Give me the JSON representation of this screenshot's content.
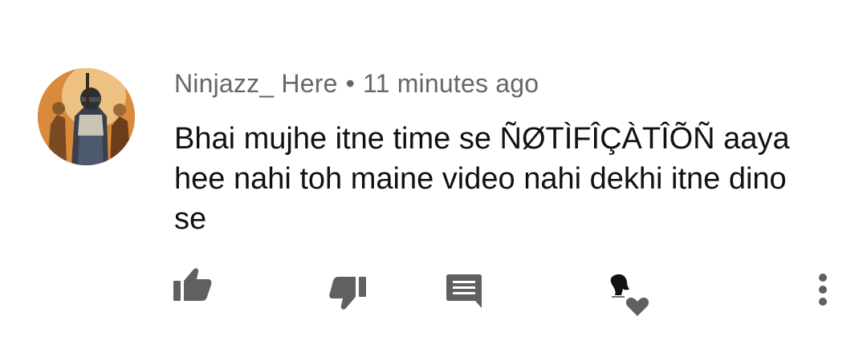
{
  "comment": {
    "author": "Ninjazz_ Here",
    "separator": "•",
    "time": "11 minutes ago",
    "text": "Bhai mujhe itne time se ÑØTÌFÎÇÀTÎÕÑ aaya hee nahi toh maine video nahi dekhi itne dino se"
  },
  "actions": {
    "like": "thumbs-up-icon",
    "dislike": "thumbs-down-icon",
    "reply": "comment-icon",
    "creator_heart": "creator-heart-icon",
    "more": "more-vertical-icon"
  },
  "colors": {
    "icon": "#606060",
    "meta_text": "#666666",
    "body_text": "#111111"
  }
}
